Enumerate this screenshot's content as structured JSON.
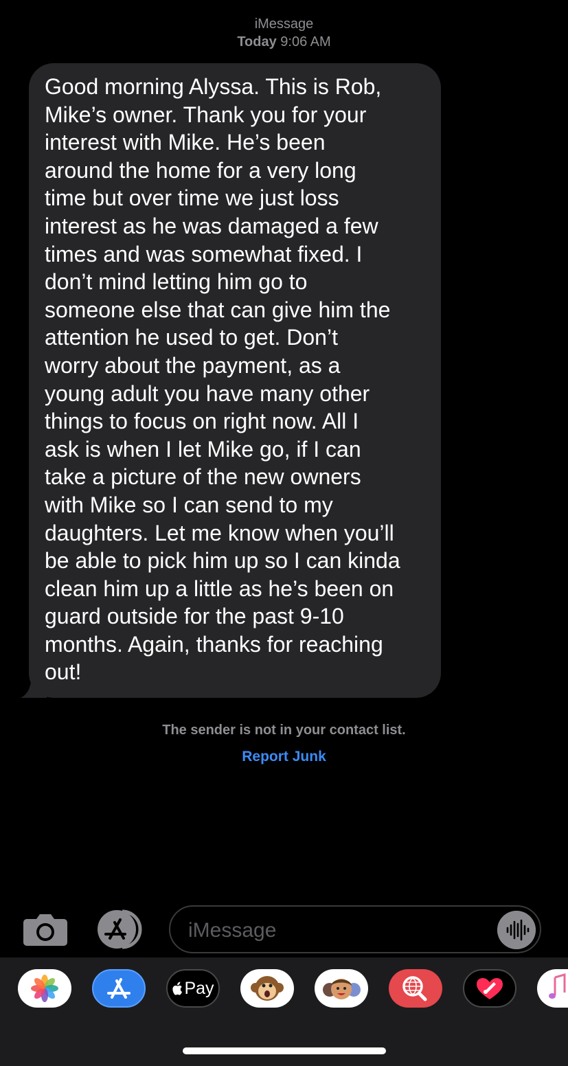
{
  "header": {
    "service": "iMessage",
    "day": "Today",
    "time": "9:06 AM"
  },
  "message": {
    "text": "Good morning Alyssa. This is Rob,\nMike’s owner. Thank you for your\ninterest with Mike. He’s been\naround the home for a very long\ntime but over time we just loss\ninterest as he was damaged a few\ntimes and was somewhat fixed. I\ndon’t mind letting him go to\nsomeone else that can give him the\nattention he used to get. Don’t\nworry about the payment, as a\nyoung adult you have many other\nthings to focus on right now. All I\nask is when I let Mike go, if I can\ntake a picture of the new owners\nwith Mike so I can send to my\ndaughters. Let me know when you’ll\nbe able to pick him up so I can kinda\nclean him up a little as he’s been on\nguard outside for the past 9-10\nmonths. Again, thanks for reaching\nout!"
  },
  "notice": {
    "text": "The sender is not in your contact list.",
    "action": "Report Junk"
  },
  "composer": {
    "placeholder": "iMessage",
    "camera_icon": "camera-icon",
    "apps_icon": "app-store-icon",
    "audio_icon": "waveform-icon"
  },
  "app_drawer": {
    "apps": [
      {
        "name": "photos",
        "label": ""
      },
      {
        "name": "app-store",
        "label": ""
      },
      {
        "name": "apple-pay",
        "label": "Pay"
      },
      {
        "name": "animoji",
        "label": ""
      },
      {
        "name": "memoji",
        "label": ""
      },
      {
        "name": "images-search",
        "label": ""
      },
      {
        "name": "digital-touch",
        "label": ""
      },
      {
        "name": "music",
        "label": ""
      }
    ]
  },
  "colors": {
    "background": "#000000",
    "bubble": "#262629",
    "link": "#3b8cf6",
    "secondary_text": "#8e8e93",
    "drawer": "#1c1c1e"
  }
}
